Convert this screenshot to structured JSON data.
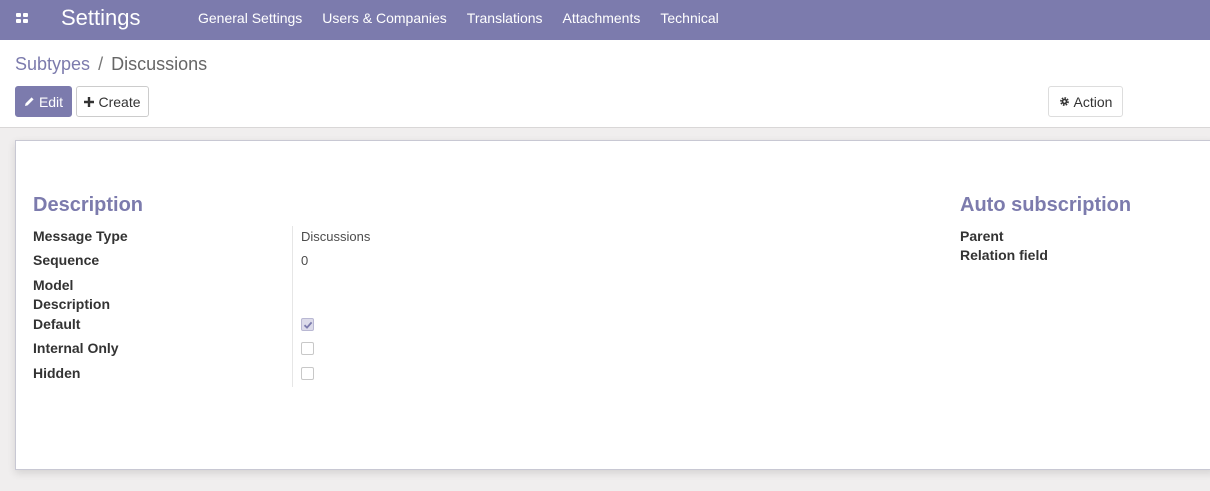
{
  "navbar": {
    "brand": "Settings",
    "menu": [
      "General Settings",
      "Users & Companies",
      "Translations",
      "Attachments",
      "Technical"
    ]
  },
  "breadcrumb": {
    "parent": "Subtypes",
    "separator": "/",
    "current": "Discussions"
  },
  "buttons": {
    "edit": "Edit",
    "create": "Create",
    "action": "Action"
  },
  "form": {
    "description_title": "Description",
    "fields": {
      "message_type": {
        "label": "Message Type",
        "value": "Discussions"
      },
      "sequence": {
        "label": "Sequence",
        "value": "0"
      },
      "model_description": {
        "label_line1": "Model",
        "label_line2": "Description"
      },
      "default": {
        "label": "Default",
        "checked": true
      },
      "internal_only": {
        "label": "Internal Only",
        "checked": false
      },
      "hidden": {
        "label": "Hidden",
        "checked": false
      }
    },
    "auto_title": "Auto subscription",
    "auto_fields": {
      "parent": "Parent",
      "relation_field": "Relation field"
    }
  },
  "colors": {
    "brand": "#7c7bad",
    "background": "#f0eeee"
  },
  "icons": [
    "apps-grid-icon",
    "pencil-icon",
    "plus-icon",
    "gear-icon",
    "checkmark-icon"
  ]
}
